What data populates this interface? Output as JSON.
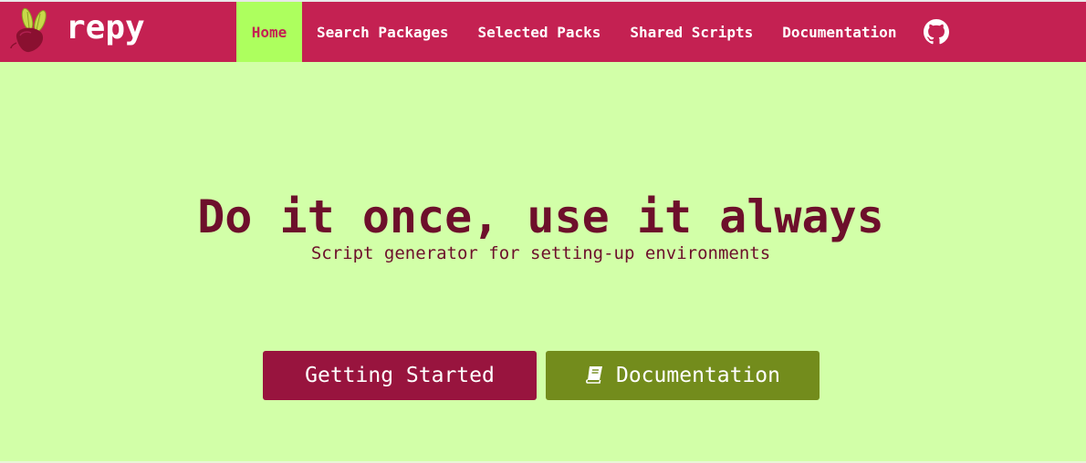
{
  "app": {
    "brand_name": "repy"
  },
  "nav": {
    "items": [
      {
        "label": "Home",
        "active": true
      },
      {
        "label": "Search Packages",
        "active": false
      },
      {
        "label": "Selected Packs",
        "active": false
      },
      {
        "label": "Shared Scripts",
        "active": false
      },
      {
        "label": "Documentation",
        "active": false
      }
    ],
    "github_icon": "github-icon"
  },
  "hero": {
    "title": "Do it once, use it always",
    "subtitle": "Script generator for setting-up environments"
  },
  "buttons": {
    "getting_started_label": "Getting Started",
    "documentation_label": "Documentation",
    "documentation_icon": "book-icon"
  },
  "colors": {
    "navbar_bg": "#c42152",
    "active_tab_bg": "#adff5e",
    "page_bg": "#d2ffa8",
    "title_color": "#6d0f2b",
    "primary_button": "#98143e",
    "secondary_button": "#738c1c"
  }
}
